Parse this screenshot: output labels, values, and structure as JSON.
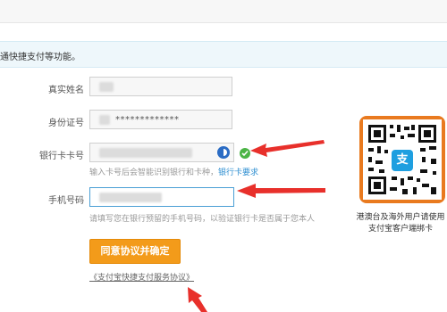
{
  "notice": {
    "text": "通快捷支付等功能。"
  },
  "form": {
    "name_label": "真实姓名",
    "id_label": "身份证号",
    "id_value": "*************",
    "card_label": "银行卡卡号",
    "card_hint": "输入卡号后会智能识别银行和卡种，",
    "card_hint_link": "银行卡要求",
    "phone_label": "手机号码",
    "phone_hint": "请填写您在银行预留的手机号码，以验证银行卡是否属于您本人"
  },
  "actions": {
    "confirm_label": "同意协议并确定",
    "agreement_link": "《支付宝快捷支付服务协议》"
  },
  "qr": {
    "center_glyph": "支",
    "caption_line1": "港澳台及海外用户请使用",
    "caption_line2": "支付宝客户端绑卡"
  },
  "colors": {
    "accent_orange": "#f39b1a",
    "qr_border": "#e97a1f",
    "link_blue": "#2f8fd1",
    "arrow_red": "#e8302b",
    "success_green": "#4bb446"
  },
  "icons": [
    "bank-logo-icon",
    "check-icon",
    "alipay-icon",
    "arrow-icon"
  ]
}
